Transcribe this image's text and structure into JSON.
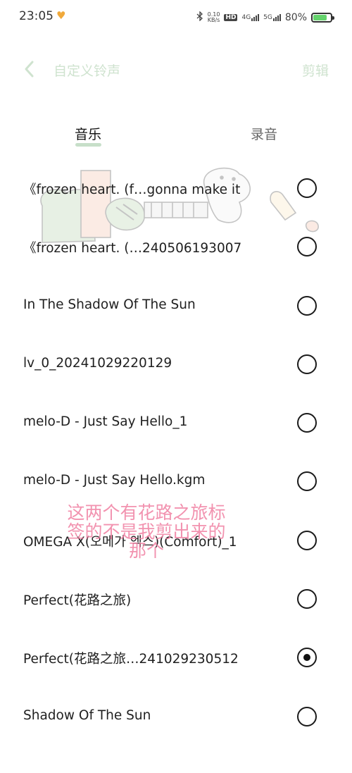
{
  "status_bar": {
    "time": "23:05",
    "net_speed_value": "0.10",
    "net_speed_unit": "KB/s",
    "hd_label": "HD",
    "sim2": "2",
    "net1": "4G",
    "net2": "5G",
    "battery_percent": "80%",
    "battery_level": 0.8
  },
  "header": {
    "title": "自定义铃声",
    "edit_label": "剪辑"
  },
  "tabs": [
    {
      "label": "音乐",
      "active": true
    },
    {
      "label": "录音",
      "active": false
    }
  ],
  "songs": [
    {
      "title": "《frozen heart. (f…gonna make it",
      "selected": false
    },
    {
      "title": "《frozen heart. (…240506193007",
      "selected": false
    },
    {
      "title": "In The Shadow Of The Sun",
      "selected": false
    },
    {
      "title": "lv_0_20241029220129",
      "selected": false
    },
    {
      "title": "melo-D - Just Say Hello_1",
      "selected": false
    },
    {
      "title": "melo-D - Just Say Hello.kgm",
      "selected": false
    },
    {
      "title": "OMEGA X(오메가 엑스)(Comfort)_1",
      "selected": false
    },
    {
      "title": "Perfect(花路之旅)",
      "selected": false
    },
    {
      "title": "Perfect(花路之旅…241029230512",
      "selected": true
    },
    {
      "title": "Shadow Of The Sun",
      "selected": false
    }
  ],
  "annotation": {
    "line1": "这两个有花路之旅标",
    "line2": "签的不是我剪出来的",
    "line3": "那个"
  },
  "colors": {
    "header_text": "#cfe3cf",
    "tab_indicator": "#c7dfc9",
    "annotation": "#f07fa2"
  }
}
